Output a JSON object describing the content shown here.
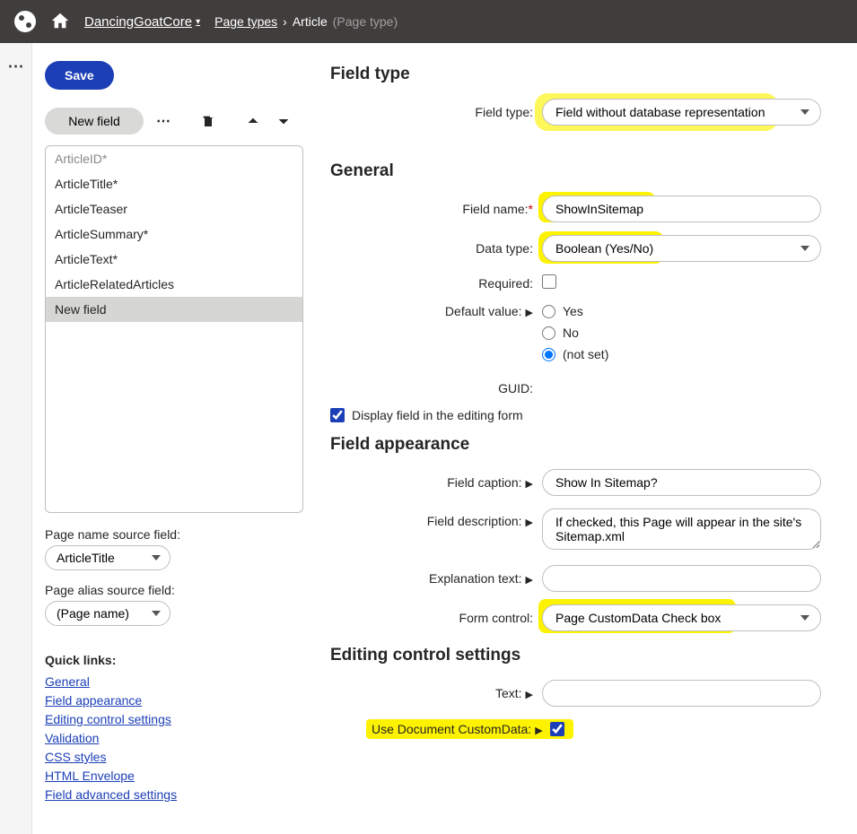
{
  "header": {
    "site_name": "DancingGoatCore",
    "breadcrumb": {
      "level1": "Page types",
      "level2": "Article",
      "suffix": "(Page type)"
    }
  },
  "actions": {
    "save": "Save",
    "new_field": "New field"
  },
  "fields": {
    "items": [
      {
        "label": "ArticleID*",
        "selected_id": true
      },
      {
        "label": "ArticleTitle*"
      },
      {
        "label": "ArticleTeaser"
      },
      {
        "label": "ArticleSummary*"
      },
      {
        "label": "ArticleText*"
      },
      {
        "label": "ArticleRelatedArticles"
      },
      {
        "label": "New field",
        "selected": true
      }
    ]
  },
  "page_name_source": {
    "label": "Page name source field:",
    "value": "ArticleTitle"
  },
  "page_alias_source": {
    "label": "Page alias source field:",
    "value": "(Page name)"
  },
  "quicklinks": {
    "title": "Quick links:",
    "items": [
      "General",
      "Field appearance",
      "Editing control settings",
      "Validation",
      "CSS styles",
      "HTML Envelope",
      "Field advanced settings"
    ]
  },
  "form": {
    "section_field_type": "Field type",
    "field_type": {
      "label": "Field type:",
      "value": "Field without database representation"
    },
    "section_general": "General",
    "field_name": {
      "label": "Field name:",
      "value": "ShowInSitemap"
    },
    "data_type": {
      "label": "Data type:",
      "value": "Boolean (Yes/No)"
    },
    "required": {
      "label": "Required:"
    },
    "default_value": {
      "label": "Default value:",
      "options": [
        "Yes",
        "No",
        "(not set)"
      ],
      "selected": "(not set)"
    },
    "guid": {
      "label": "GUID:",
      "value": ""
    },
    "display_in_form": {
      "label": "Display field in the editing form",
      "checked": true
    },
    "section_appearance": "Field appearance",
    "field_caption": {
      "label": "Field caption:",
      "value": "Show In Sitemap?"
    },
    "field_description": {
      "label": "Field description:",
      "value": "If checked, this Page will appear in the site's Sitemap.xml"
    },
    "explanation": {
      "label": "Explanation text:",
      "value": ""
    },
    "form_control": {
      "label": "Form control:",
      "value": "Page CustomData Check box"
    },
    "section_editing": "Editing control settings",
    "text": {
      "label": "Text:",
      "value": ""
    },
    "use_doc_customdata": {
      "label": "Use Document CustomData:",
      "checked": true
    }
  }
}
